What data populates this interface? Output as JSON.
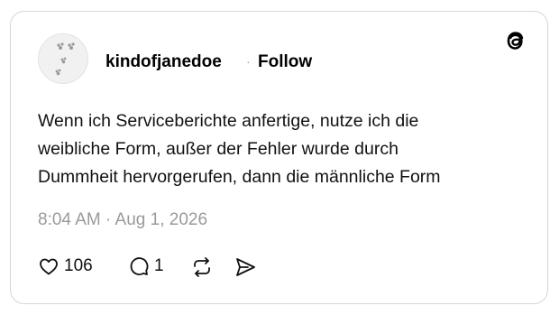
{
  "post": {
    "author": {
      "username": "kindofjanedoe",
      "separator": "·",
      "follow_label": "Follow"
    },
    "app_logo_icon": "threads-logo-icon",
    "text_lines": [
      "Wenn ich Serviceberichte anfertige, nutze ich die",
      "weibliche Form, außer der Fehler wurde durch",
      "Dummheit hervorgerufen, dann die männliche Form"
    ],
    "timestamp": "8:04 AM · Aug 1, 2026",
    "actions": {
      "like": {
        "icon": "heart-icon",
        "count": "106"
      },
      "reply": {
        "icon": "comment-icon",
        "count": "1"
      },
      "repost": {
        "icon": "repost-icon"
      },
      "share": {
        "icon": "send-icon"
      }
    }
  },
  "colors": {
    "text": "#111111",
    "muted": "#9a9a9a",
    "border": "#d6d6d6"
  }
}
